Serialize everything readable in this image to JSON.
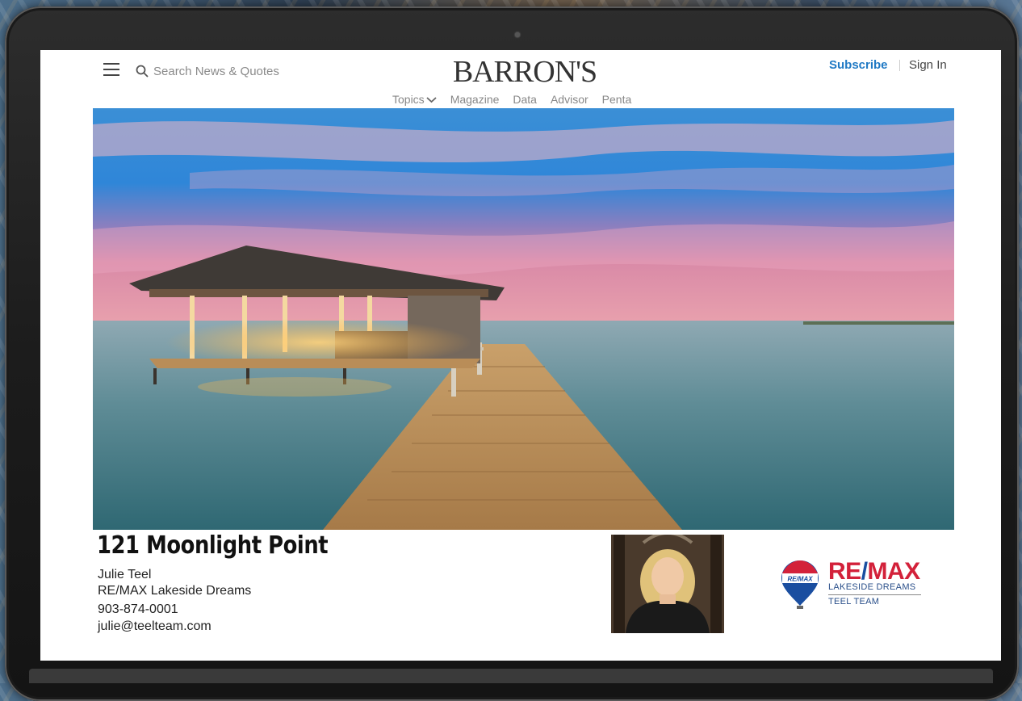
{
  "header": {
    "search_placeholder": "Search News & Quotes",
    "logo": "BARRON'S",
    "subscribe_label": "Subscribe",
    "signin_label": "Sign In",
    "nav": [
      "Topics",
      "Magazine",
      "Data",
      "Advisor",
      "Penta"
    ],
    "accent_color": "#1f79c4"
  },
  "listing": {
    "title": "121 Moonlight Point",
    "agent_name": "Julie Teel",
    "brokerage": "RE/MAX Lakeside Dreams",
    "phone": "903-874-0001",
    "email": "julie@teelteam.com"
  },
  "brand_logo": {
    "name_main": "RE",
    "name_slash": "/",
    "name_end": "MAX",
    "line1": "LAKESIDE DREAMS",
    "line2": "TEEL TEAM",
    "balloon_text": "RE/MAX",
    "colors": {
      "red": "#d3213a",
      "blue": "#1a4ea0"
    }
  }
}
